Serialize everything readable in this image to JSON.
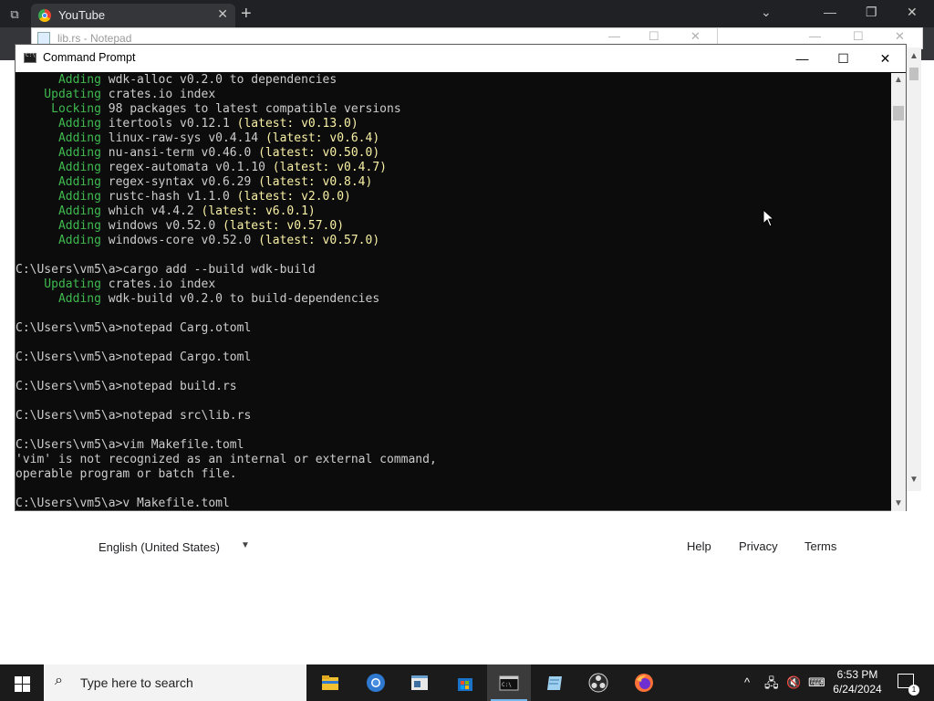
{
  "browser": {
    "tab_title": "YouTube",
    "tab_close": "✕",
    "new_tab": "+",
    "tab_search": "⧉"
  },
  "notepad": {
    "title": "lib.rs - Notepad"
  },
  "cmd": {
    "title": "Command Prompt",
    "lines": [
      [
        [
          "      Adding",
          "green"
        ],
        [
          " wdk-alloc v0.2.0 to dependencies",
          "wht"
        ]
      ],
      [
        [
          "    Updating",
          "green"
        ],
        [
          " crates.io index",
          "wht"
        ]
      ],
      [
        [
          "     Locking",
          "green"
        ],
        [
          " 98 packages to latest compatible versions",
          "wht"
        ]
      ],
      [
        [
          "      Adding",
          "green"
        ],
        [
          " itertools v0.12.1 ",
          "wht"
        ],
        [
          "(latest: v0.13.0)",
          "yel"
        ]
      ],
      [
        [
          "      Adding",
          "green"
        ],
        [
          " linux-raw-sys v0.4.14 ",
          "wht"
        ],
        [
          "(latest: v0.6.4)",
          "yel"
        ]
      ],
      [
        [
          "      Adding",
          "green"
        ],
        [
          " nu-ansi-term v0.46.0 ",
          "wht"
        ],
        [
          "(latest: v0.50.0)",
          "yel"
        ]
      ],
      [
        [
          "      Adding",
          "green"
        ],
        [
          " regex-automata v0.1.10 ",
          "wht"
        ],
        [
          "(latest: v0.4.7)",
          "yel"
        ]
      ],
      [
        [
          "      Adding",
          "green"
        ],
        [
          " regex-syntax v0.6.29 ",
          "wht"
        ],
        [
          "(latest: v0.8.4)",
          "yel"
        ]
      ],
      [
        [
          "      Adding",
          "green"
        ],
        [
          " rustc-hash v1.1.0 ",
          "wht"
        ],
        [
          "(latest: v2.0.0)",
          "yel"
        ]
      ],
      [
        [
          "      Adding",
          "green"
        ],
        [
          " which v4.4.2 ",
          "wht"
        ],
        [
          "(latest: v6.0.1)",
          "yel"
        ]
      ],
      [
        [
          "      Adding",
          "green"
        ],
        [
          " windows v0.52.0 ",
          "wht"
        ],
        [
          "(latest: v0.57.0)",
          "yel"
        ]
      ],
      [
        [
          "      Adding",
          "green"
        ],
        [
          " windows-core v0.52.0 ",
          "wht"
        ],
        [
          "(latest: v0.57.0)",
          "yel"
        ]
      ],
      [
        [
          "",
          "wht"
        ]
      ],
      [
        [
          "C:\\Users\\vm5\\a>cargo add --build wdk-build",
          "wht"
        ]
      ],
      [
        [
          "    Updating",
          "green"
        ],
        [
          " crates.io index",
          "wht"
        ]
      ],
      [
        [
          "      Adding",
          "green"
        ],
        [
          " wdk-build v0.2.0 to build-dependencies",
          "wht"
        ]
      ],
      [
        [
          "",
          "wht"
        ]
      ],
      [
        [
          "C:\\Users\\vm5\\a>notepad Carg.otoml",
          "wht"
        ]
      ],
      [
        [
          "",
          "wht"
        ]
      ],
      [
        [
          "C:\\Users\\vm5\\a>notepad Cargo.toml",
          "wht"
        ]
      ],
      [
        [
          "",
          "wht"
        ]
      ],
      [
        [
          "C:\\Users\\vm5\\a>notepad build.rs",
          "wht"
        ]
      ],
      [
        [
          "",
          "wht"
        ]
      ],
      [
        [
          "C:\\Users\\vm5\\a>notepad src\\lib.rs",
          "wht"
        ]
      ],
      [
        [
          "",
          "wht"
        ]
      ],
      [
        [
          "C:\\Users\\vm5\\a>vim Makefile.toml",
          "wht"
        ]
      ],
      [
        [
          "'vim' is not recognized as an internal or external command,",
          "wht"
        ]
      ],
      [
        [
          "operable program or batch file.",
          "wht"
        ]
      ],
      [
        [
          "",
          "wht"
        ]
      ],
      [
        [
          "C:\\Users\\vm5\\a>v Makefile.toml",
          "wht"
        ]
      ]
    ]
  },
  "footer": {
    "language": "English (United States)",
    "links": [
      "Help",
      "Privacy",
      "Terms"
    ]
  },
  "taskbar": {
    "search_placeholder": "Type here to search",
    "time": "6:53 PM",
    "date": "6/24/2024",
    "notification_count": "1"
  }
}
